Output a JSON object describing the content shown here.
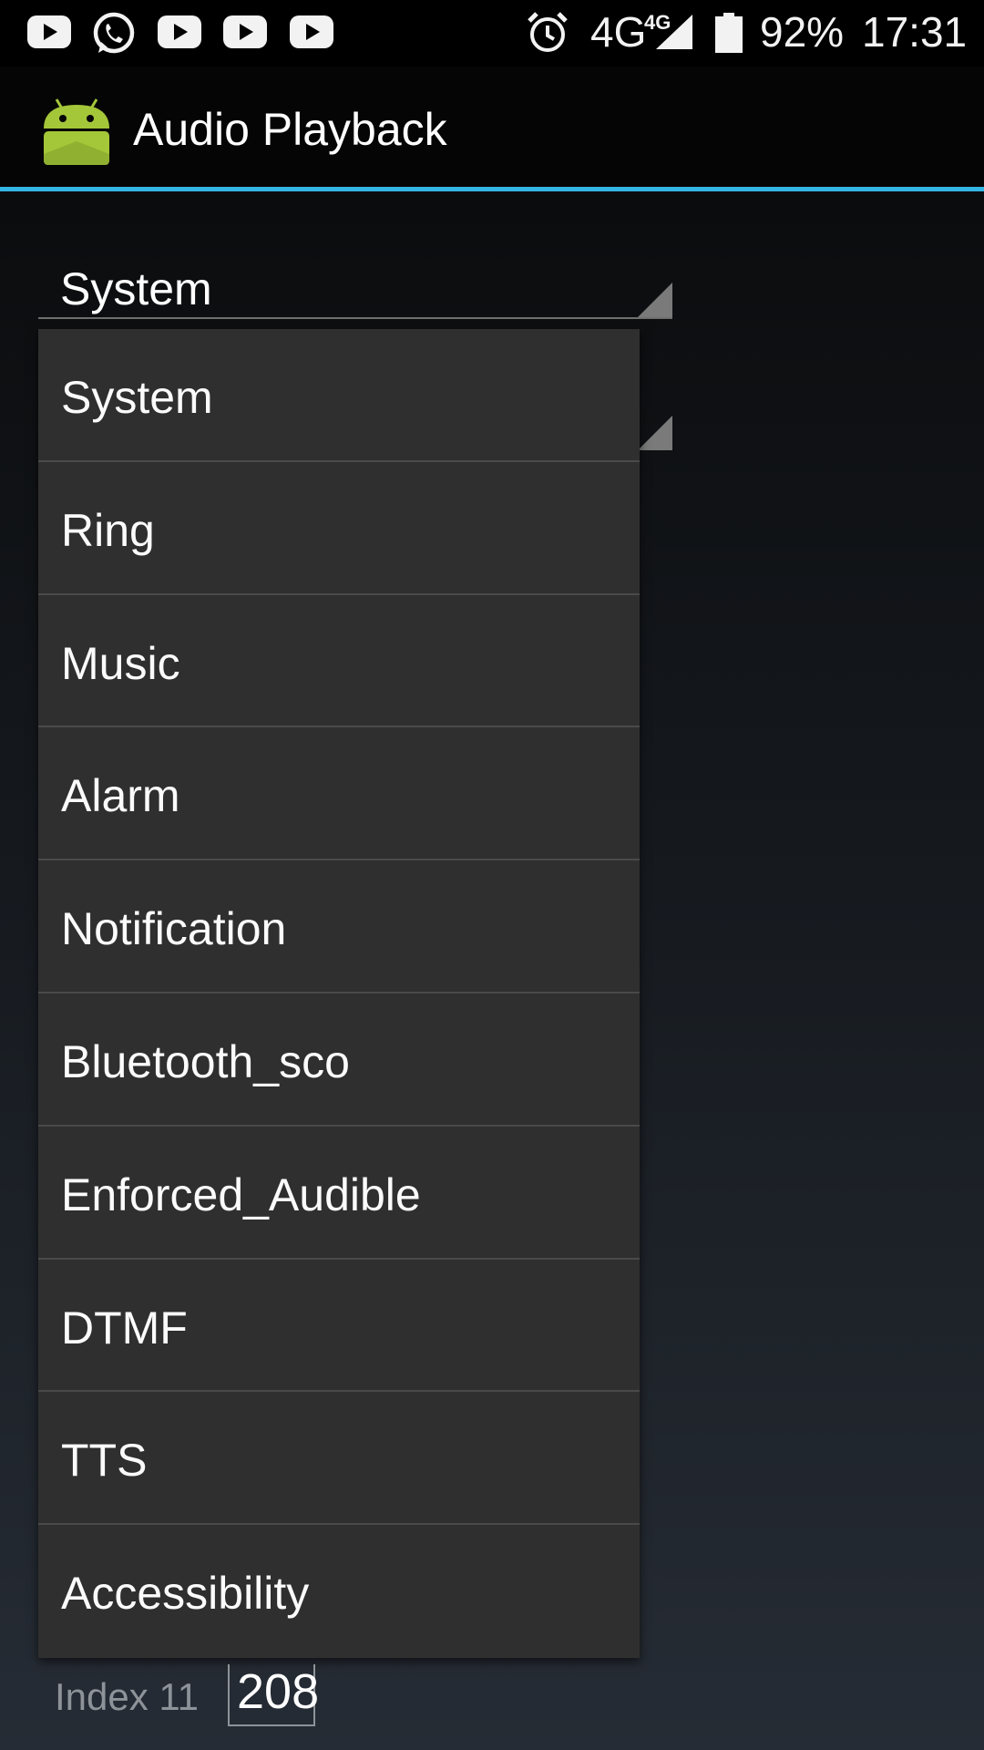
{
  "status_bar": {
    "notification_icons": [
      "youtube-icon",
      "whatsapp-icon",
      "youtube-icon",
      "youtube-icon",
      "youtube-icon"
    ],
    "alarm_icon": "alarm-clock-icon",
    "network": "4G",
    "network_small": "4G",
    "signal_icon": "signal-icon",
    "battery_icon": "battery-icon",
    "battery": "92%",
    "time": "17:31"
  },
  "action_bar": {
    "app_icon": "android-icon",
    "title": "Audio Playback",
    "accent_color": "#33b5e5"
  },
  "spinner": {
    "selected": "System"
  },
  "dropdown": {
    "items": [
      {
        "label": "System"
      },
      {
        "label": "Ring"
      },
      {
        "label": "Music"
      },
      {
        "label": "Alarm"
      },
      {
        "label": "Notification"
      },
      {
        "label": "Bluetooth_sco"
      },
      {
        "label": "Enforced_Audible"
      },
      {
        "label": "DTMF"
      },
      {
        "label": "TTS"
      },
      {
        "label": "Accessibility"
      }
    ]
  },
  "index_row": {
    "label": "Index 11",
    "value": "208"
  }
}
